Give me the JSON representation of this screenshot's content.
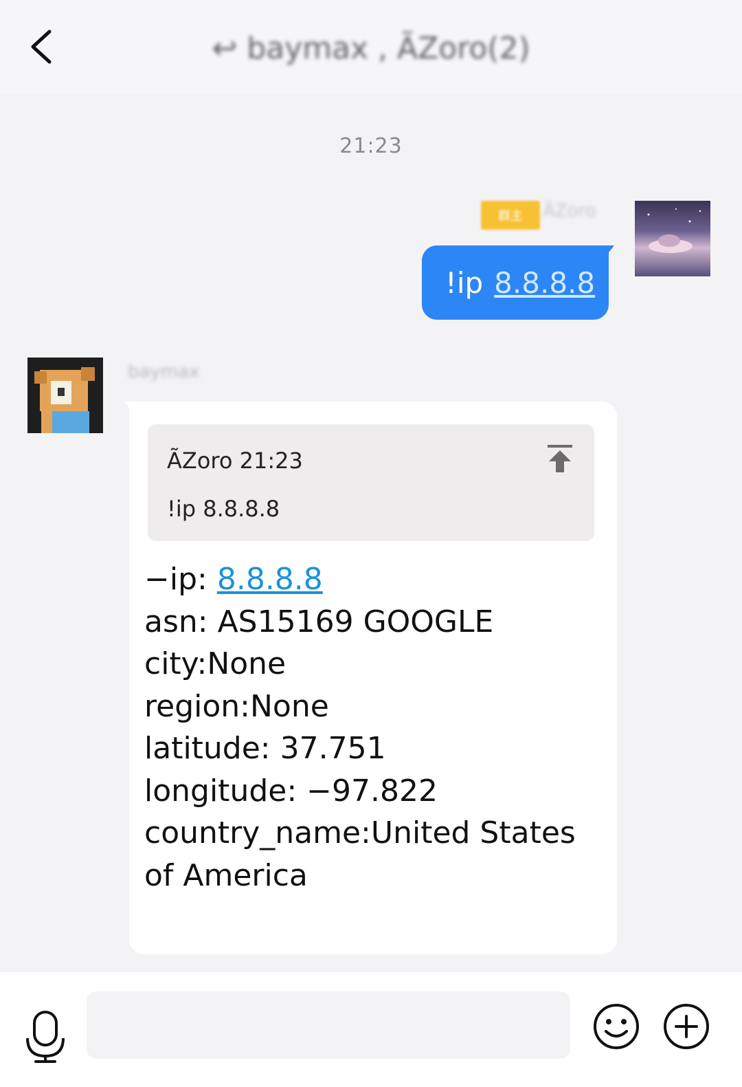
{
  "header": {
    "title": "↩ baymax , ÃZoro(2)"
  },
  "chat": {
    "timestamp": "21:23",
    "sent": {
      "tag": "群主",
      "sender_name": "ÃZoro",
      "prefix": "!ip",
      "link": "8.8.8.8"
    },
    "received": {
      "sender_name": "baymax",
      "quote": {
        "meta": "ÃZoro 21:23",
        "text": "!ip 8.8.8.8"
      },
      "ip_label": "−ip: ",
      "ip_link": "8.8.8.8",
      "lines": [
        "asn: AS15169 GOOGLE",
        "city:None",
        "region:None",
        "latitude:  37.751",
        "longitude:  −97.822",
        "country_name:United States of America"
      ]
    }
  },
  "input": {
    "placeholder": ""
  },
  "icons": {
    "back": "back-arrow-icon",
    "jump": "jump-to-top-icon",
    "mic": "microphone-icon",
    "emoji": "smiley-icon",
    "plus": "plus-circle-icon"
  }
}
